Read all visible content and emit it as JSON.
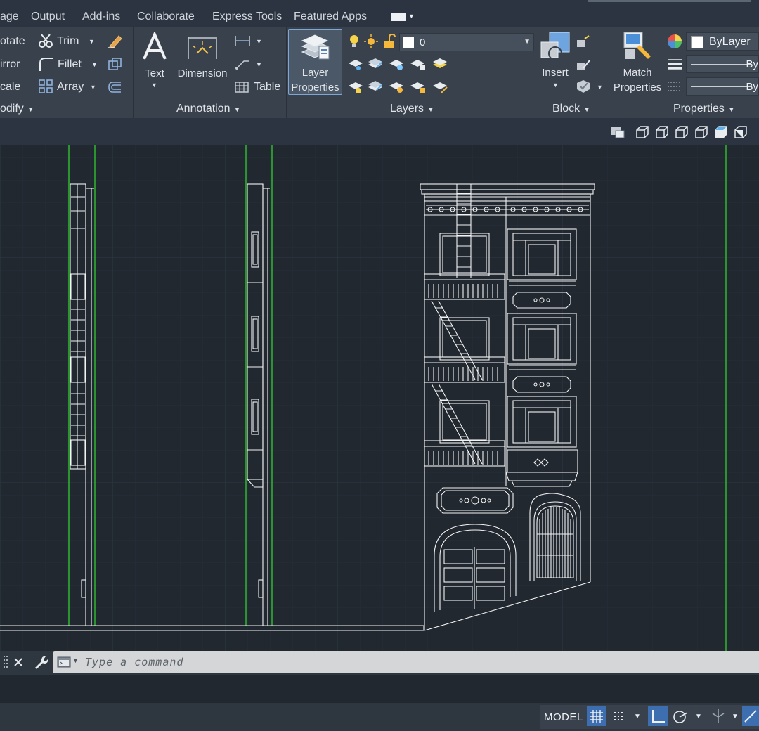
{
  "ribbon_tabs": [
    "age",
    "Output",
    "Add-ins",
    "Collaborate",
    "Express Tools",
    "Featured Apps"
  ],
  "modify": {
    "rotate": "otate",
    "mirror": "irror",
    "scale": "cale",
    "trim": "Trim",
    "fillet": "Fillet",
    "array": "Array",
    "title": "odify"
  },
  "annotation": {
    "text": "Text",
    "dimension": "Dimension",
    "table": "Table",
    "title": "Annotation"
  },
  "layers": {
    "layer_properties_line1": "Layer",
    "layer_properties_line2": "Properties",
    "current_layer": "0",
    "title": "Layers"
  },
  "block": {
    "insert": "Insert",
    "title": "Block"
  },
  "properties": {
    "match_line1": "Match",
    "match_line2": "Properties",
    "color": "ByLayer",
    "lineweight_trunc": "By",
    "linetype_trunc": "By",
    "title": "Properties"
  },
  "command": {
    "placeholder": "Type a command"
  },
  "status": {
    "model": "MODEL"
  },
  "icons": [
    "trim-icon",
    "fillet-icon",
    "array-icon",
    "text-icon",
    "dimension-icon",
    "table-icon",
    "layer-properties-icon",
    "insert-icon",
    "match-properties-icon",
    "close-icon",
    "wrench-icon",
    "grid-icon",
    "snap-icon",
    "ortho-icon",
    "polar-icon"
  ],
  "colors": {
    "ribbon_bg": "#39414d",
    "canvas_bg": "#212830",
    "grid": "#2c3440",
    "drawing_lines": "#ffffff",
    "guide_lines": "#2fb82f",
    "active_toggle": "#3d6fb0"
  }
}
